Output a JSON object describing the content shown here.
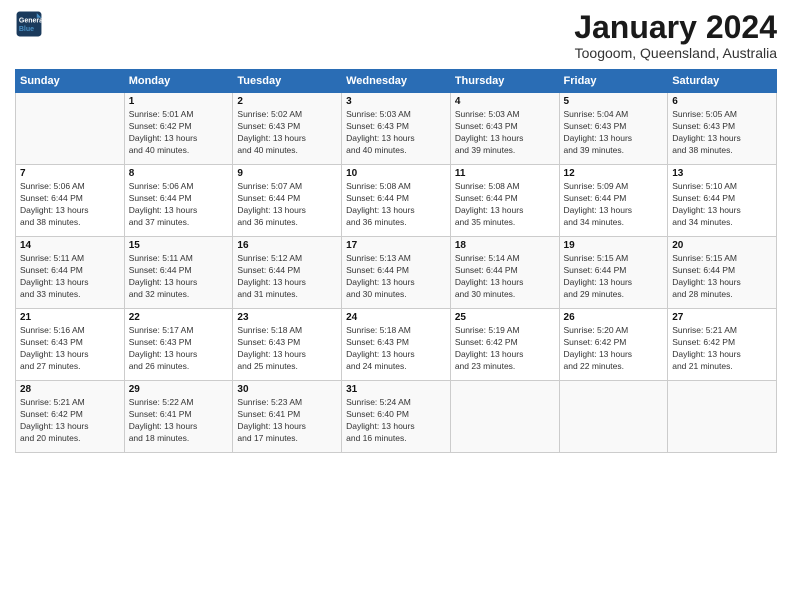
{
  "header": {
    "logo_line1": "General",
    "logo_line2": "Blue",
    "month": "January 2024",
    "location": "Toogoom, Queensland, Australia"
  },
  "weekdays": [
    "Sunday",
    "Monday",
    "Tuesday",
    "Wednesday",
    "Thursday",
    "Friday",
    "Saturday"
  ],
  "weeks": [
    [
      {
        "day": "",
        "content": ""
      },
      {
        "day": "1",
        "content": "Sunrise: 5:01 AM\nSunset: 6:42 PM\nDaylight: 13 hours\nand 40 minutes."
      },
      {
        "day": "2",
        "content": "Sunrise: 5:02 AM\nSunset: 6:43 PM\nDaylight: 13 hours\nand 40 minutes."
      },
      {
        "day": "3",
        "content": "Sunrise: 5:03 AM\nSunset: 6:43 PM\nDaylight: 13 hours\nand 40 minutes."
      },
      {
        "day": "4",
        "content": "Sunrise: 5:03 AM\nSunset: 6:43 PM\nDaylight: 13 hours\nand 39 minutes."
      },
      {
        "day": "5",
        "content": "Sunrise: 5:04 AM\nSunset: 6:43 PM\nDaylight: 13 hours\nand 39 minutes."
      },
      {
        "day": "6",
        "content": "Sunrise: 5:05 AM\nSunset: 6:43 PM\nDaylight: 13 hours\nand 38 minutes."
      }
    ],
    [
      {
        "day": "7",
        "content": "Sunrise: 5:06 AM\nSunset: 6:44 PM\nDaylight: 13 hours\nand 38 minutes."
      },
      {
        "day": "8",
        "content": "Sunrise: 5:06 AM\nSunset: 6:44 PM\nDaylight: 13 hours\nand 37 minutes."
      },
      {
        "day": "9",
        "content": "Sunrise: 5:07 AM\nSunset: 6:44 PM\nDaylight: 13 hours\nand 36 minutes."
      },
      {
        "day": "10",
        "content": "Sunrise: 5:08 AM\nSunset: 6:44 PM\nDaylight: 13 hours\nand 36 minutes."
      },
      {
        "day": "11",
        "content": "Sunrise: 5:08 AM\nSunset: 6:44 PM\nDaylight: 13 hours\nand 35 minutes."
      },
      {
        "day": "12",
        "content": "Sunrise: 5:09 AM\nSunset: 6:44 PM\nDaylight: 13 hours\nand 34 minutes."
      },
      {
        "day": "13",
        "content": "Sunrise: 5:10 AM\nSunset: 6:44 PM\nDaylight: 13 hours\nand 34 minutes."
      }
    ],
    [
      {
        "day": "14",
        "content": "Sunrise: 5:11 AM\nSunset: 6:44 PM\nDaylight: 13 hours\nand 33 minutes."
      },
      {
        "day": "15",
        "content": "Sunrise: 5:11 AM\nSunset: 6:44 PM\nDaylight: 13 hours\nand 32 minutes."
      },
      {
        "day": "16",
        "content": "Sunrise: 5:12 AM\nSunset: 6:44 PM\nDaylight: 13 hours\nand 31 minutes."
      },
      {
        "day": "17",
        "content": "Sunrise: 5:13 AM\nSunset: 6:44 PM\nDaylight: 13 hours\nand 30 minutes."
      },
      {
        "day": "18",
        "content": "Sunrise: 5:14 AM\nSunset: 6:44 PM\nDaylight: 13 hours\nand 30 minutes."
      },
      {
        "day": "19",
        "content": "Sunrise: 5:15 AM\nSunset: 6:44 PM\nDaylight: 13 hours\nand 29 minutes."
      },
      {
        "day": "20",
        "content": "Sunrise: 5:15 AM\nSunset: 6:44 PM\nDaylight: 13 hours\nand 28 minutes."
      }
    ],
    [
      {
        "day": "21",
        "content": "Sunrise: 5:16 AM\nSunset: 6:43 PM\nDaylight: 13 hours\nand 27 minutes."
      },
      {
        "day": "22",
        "content": "Sunrise: 5:17 AM\nSunset: 6:43 PM\nDaylight: 13 hours\nand 26 minutes."
      },
      {
        "day": "23",
        "content": "Sunrise: 5:18 AM\nSunset: 6:43 PM\nDaylight: 13 hours\nand 25 minutes."
      },
      {
        "day": "24",
        "content": "Sunrise: 5:18 AM\nSunset: 6:43 PM\nDaylight: 13 hours\nand 24 minutes."
      },
      {
        "day": "25",
        "content": "Sunrise: 5:19 AM\nSunset: 6:42 PM\nDaylight: 13 hours\nand 23 minutes."
      },
      {
        "day": "26",
        "content": "Sunrise: 5:20 AM\nSunset: 6:42 PM\nDaylight: 13 hours\nand 22 minutes."
      },
      {
        "day": "27",
        "content": "Sunrise: 5:21 AM\nSunset: 6:42 PM\nDaylight: 13 hours\nand 21 minutes."
      }
    ],
    [
      {
        "day": "28",
        "content": "Sunrise: 5:21 AM\nSunset: 6:42 PM\nDaylight: 13 hours\nand 20 minutes."
      },
      {
        "day": "29",
        "content": "Sunrise: 5:22 AM\nSunset: 6:41 PM\nDaylight: 13 hours\nand 18 minutes."
      },
      {
        "day": "30",
        "content": "Sunrise: 5:23 AM\nSunset: 6:41 PM\nDaylight: 13 hours\nand 17 minutes."
      },
      {
        "day": "31",
        "content": "Sunrise: 5:24 AM\nSunset: 6:40 PM\nDaylight: 13 hours\nand 16 minutes."
      },
      {
        "day": "",
        "content": ""
      },
      {
        "day": "",
        "content": ""
      },
      {
        "day": "",
        "content": ""
      }
    ]
  ]
}
